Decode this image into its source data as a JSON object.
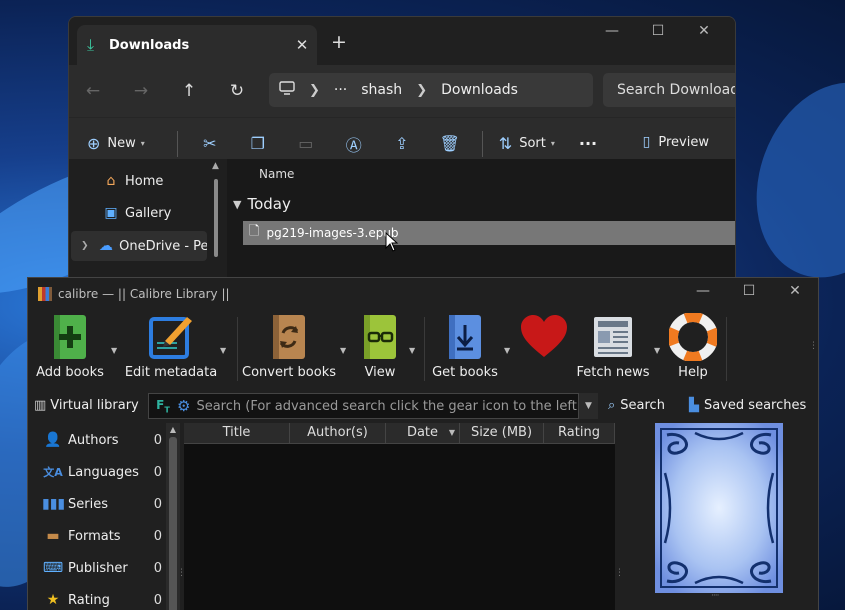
{
  "explorer": {
    "tab_title": "Downloads",
    "tab_close": "✕",
    "new_tab": "+",
    "controls": [
      "—",
      "☐",
      "✕"
    ],
    "nav": {
      "back": "←",
      "forward": "→",
      "up": "↑",
      "refresh": "↻"
    },
    "address": {
      "ellipsis": "···",
      "segments": [
        "shash",
        "Downloads"
      ]
    },
    "search_placeholder": "Search Downloads",
    "cmd": {
      "new_label": "New",
      "sort_label": "Sort",
      "more": "···",
      "preview_label": "Preview"
    },
    "nav_pane": [
      {
        "label": "Home",
        "icon": "home-icon"
      },
      {
        "label": "Gallery",
        "icon": "gallery-icon"
      },
      {
        "label": "OneDrive - Per",
        "icon": "cloud-icon"
      }
    ],
    "columns": {
      "name": "Name"
    },
    "group": "Today",
    "file": "pg219-images-3.epub"
  },
  "calibre": {
    "title": "calibre — || Calibre Library ||",
    "controls": [
      "—",
      "☐",
      "✕"
    ],
    "toolbar": [
      {
        "label": "Add books",
        "icon": "add-books-icon"
      },
      {
        "label": "Edit metadata",
        "icon": "edit-metadata-icon"
      },
      {
        "label": "Convert books",
        "icon": "convert-books-icon"
      },
      {
        "label": "View",
        "icon": "view-icon"
      },
      {
        "label": "Get books",
        "icon": "get-books-icon"
      },
      {
        "label": "",
        "icon": "heart-icon"
      },
      {
        "label": "Fetch news",
        "icon": "fetch-news-icon"
      },
      {
        "label": "Help",
        "icon": "help-icon"
      }
    ],
    "virtual_library": "Virtual library",
    "search_placeholder": "Search (For advanced search click the gear icon to the left)",
    "search_button": "Search",
    "saved_searches": "Saved searches",
    "tag_browser": [
      {
        "label": "Authors",
        "count": "0",
        "icon": "authors-icon"
      },
      {
        "label": "Languages",
        "count": "0",
        "icon": "languages-icon"
      },
      {
        "label": "Series",
        "count": "0",
        "icon": "series-icon"
      },
      {
        "label": "Formats",
        "count": "0",
        "icon": "formats-icon"
      },
      {
        "label": "Publisher",
        "count": "0",
        "icon": "publisher-icon"
      },
      {
        "label": "Rating",
        "count": "0",
        "icon": "rating-icon"
      }
    ],
    "columns": [
      "Title",
      "Author(s)",
      "Date",
      "Size (MB)",
      "Rating"
    ]
  }
}
